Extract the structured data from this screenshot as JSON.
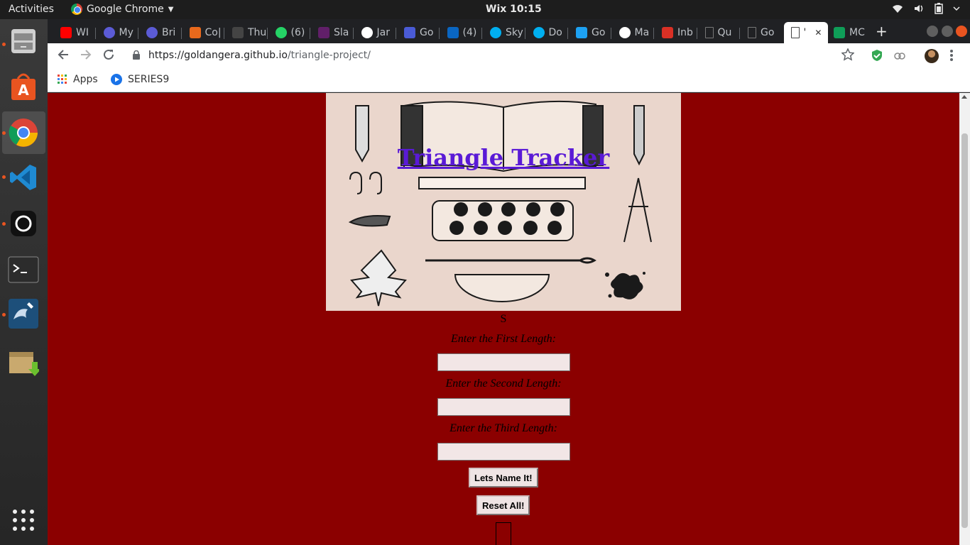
{
  "system": {
    "activities": "Activities",
    "app_name": "Google Chrome",
    "clock": "Wix 10:15"
  },
  "tabs": [
    {
      "label": "WI",
      "icon": "youtube-icon",
      "color": "#ff0000"
    },
    {
      "label": "My",
      "icon": "circle-logo-icon",
      "color": "#5b5bd6"
    },
    {
      "label": "Bri",
      "icon": "circle-logo-icon",
      "color": "#5b5bd6"
    },
    {
      "label": "Co|",
      "icon": "p-logo-icon",
      "color": "#e8691c"
    },
    {
      "label": "Thu",
      "icon": "blank-icon",
      "color": "#444444"
    },
    {
      "label": "(6)",
      "icon": "whatsapp-icon",
      "color": "#25d366"
    },
    {
      "label": "Sla",
      "icon": "slack-icon",
      "color": "#611f69"
    },
    {
      "label": "Jar",
      "icon": "github-icon",
      "color": "#ffffff"
    },
    {
      "label": "Go",
      "icon": "calendar-icon",
      "color": "#4a5bd6"
    },
    {
      "label": "(4)",
      "icon": "linkedin-icon",
      "color": "#0a66c2"
    },
    {
      "label": "Sky",
      "icon": "skype-icon",
      "color": "#00aff0"
    },
    {
      "label": "Do",
      "icon": "skype-icon",
      "color": "#00aff0"
    },
    {
      "label": "Go",
      "icon": "twitter-icon",
      "color": "#1da1f2"
    },
    {
      "label": "Ma",
      "icon": "github-icon",
      "color": "#ffffff"
    },
    {
      "label": "Inb",
      "icon": "gmail-icon",
      "color": "#d93025"
    },
    {
      "label": "Qu",
      "icon": "doc-icon",
      "color": "#444444"
    },
    {
      "label": "Go",
      "icon": "doc-icon",
      "color": "#444444"
    },
    {
      "label": "'",
      "icon": "doc-icon",
      "color": "#333333",
      "active": true
    },
    {
      "label": "MC",
      "icon": "sheets-plus-icon",
      "color": "#0f9d58"
    }
  ],
  "toolbar": {
    "url_host": "https://goldangera.github.io",
    "url_path": "/triangle-project/"
  },
  "bookmarks": {
    "apps": "Apps",
    "series": "SERIES9"
  },
  "page": {
    "title": "Triangle Tracker",
    "letter": "S",
    "label_first": "Enter the First Length:",
    "label_second": "Enter the Second Length:",
    "label_third": "Enter the Third Length:",
    "input_first": "",
    "input_second": "",
    "input_third": "",
    "button_name": "Lets Name It!",
    "button_reset": "Reset All!",
    "background_color": "#8b0000",
    "title_color": "#5a1ad6"
  }
}
